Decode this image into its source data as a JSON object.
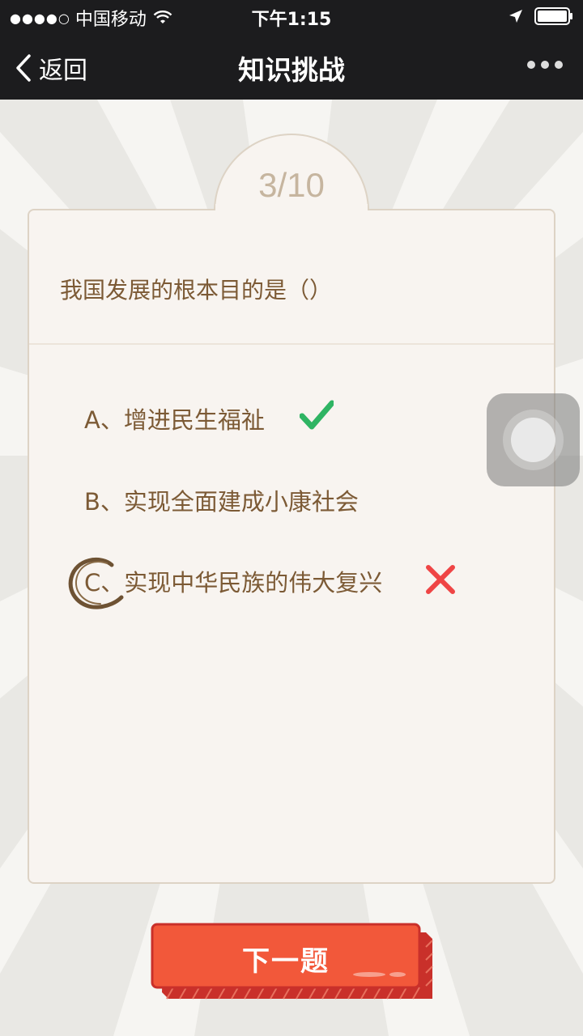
{
  "status_bar": {
    "signal_dots": "●●●●○",
    "carrier": "中国移动",
    "time": "下午1:15"
  },
  "nav": {
    "back_label": "返回",
    "title": "知识挑战"
  },
  "quiz": {
    "progress": "3/10",
    "question": "我国发展的根本目的是（）",
    "options": [
      {
        "letter": "A、",
        "text": "增进民生福祉",
        "state": "correct"
      },
      {
        "letter": "B、",
        "text": "实现全面建成小康社会",
        "state": "none"
      },
      {
        "letter": "C、",
        "text": "实现中华民族的伟大复兴",
        "state": "selected-wrong"
      }
    ]
  },
  "actions": {
    "next_label": "下一题"
  },
  "colors": {
    "accent_button": "#f2583a",
    "text_brown": "#7c5a35",
    "correct_green": "#2fb463",
    "wrong_red": "#ef4545"
  }
}
